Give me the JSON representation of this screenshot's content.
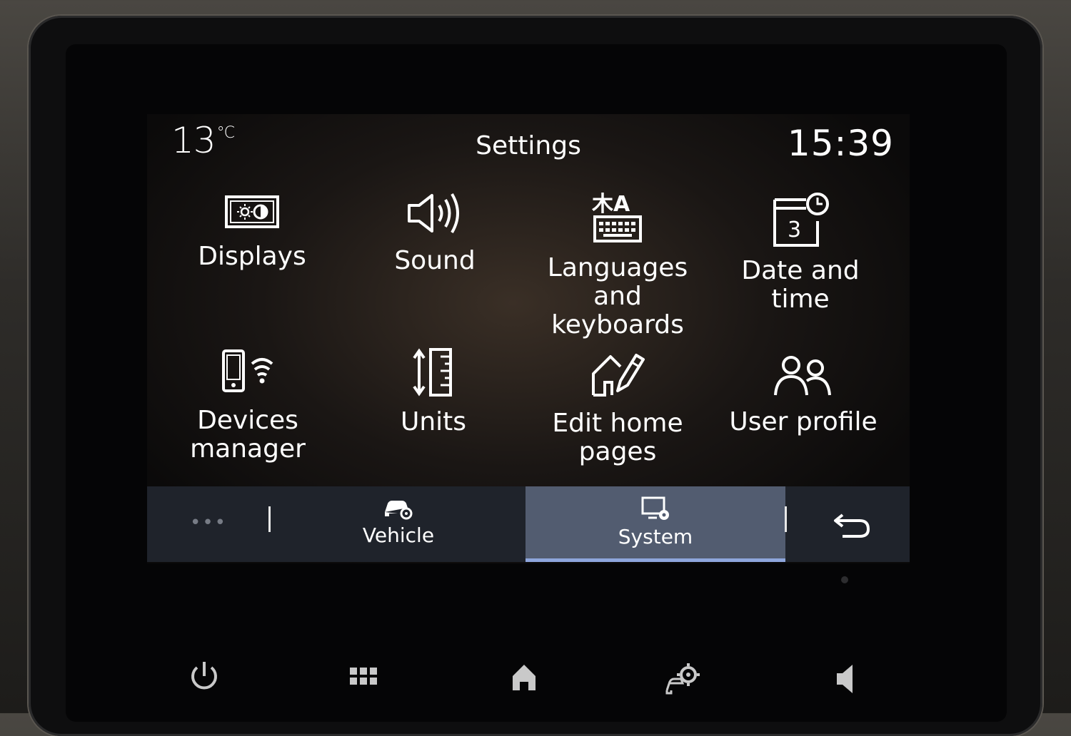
{
  "status": {
    "temperature": "13",
    "temperature_unit": "°C",
    "title": "Settings",
    "time": "15:39"
  },
  "settings": [
    {
      "label": "Displays",
      "icon": "display-brightness-icon"
    },
    {
      "label": "Sound",
      "icon": "speaker-icon"
    },
    {
      "label": "Languages and keyboards",
      "icon": "language-keyboard-icon"
    },
    {
      "label": "Date and time",
      "icon": "calendar-clock-icon",
      "calendar_day": "3"
    },
    {
      "label": "Devices manager",
      "icon": "phone-wifi-icon"
    },
    {
      "label": "Units",
      "icon": "ruler-icon"
    },
    {
      "label": "Edit home pages",
      "icon": "edit-home-icon"
    },
    {
      "label": "User profile",
      "icon": "users-icon"
    }
  ],
  "tabs": {
    "more": "•••",
    "vehicle": "Vehicle",
    "system": "System",
    "active": "System"
  },
  "hardware": [
    "power-icon",
    "apps-grid-icon",
    "home-icon",
    "vehicle-settings-icon",
    "volume-icon"
  ],
  "colors": {
    "active_tab_bg": "#525c70",
    "active_tab_underline": "#8ea6dc",
    "tab_bar_bg": "#1f232b"
  }
}
